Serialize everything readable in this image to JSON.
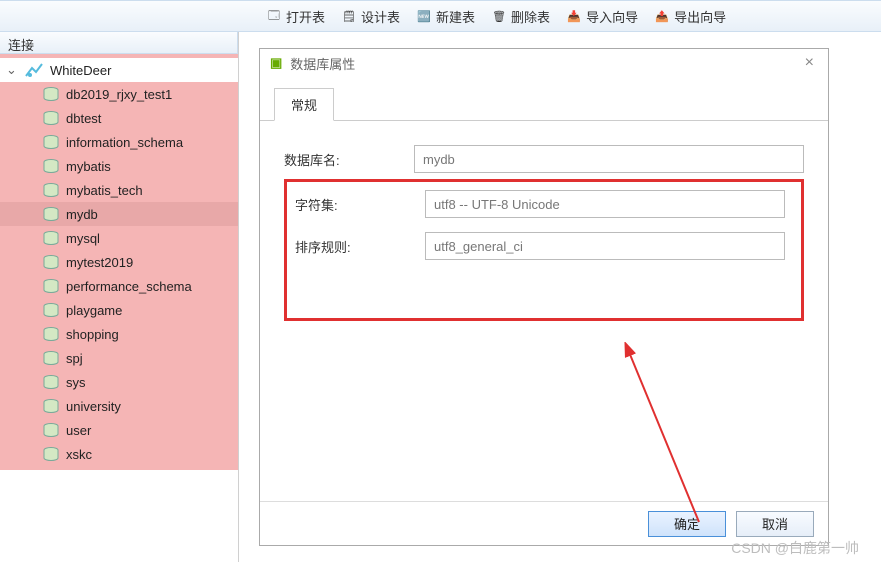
{
  "toolbar": {
    "open_table": "打开表",
    "design_table": "设计表",
    "new_table": "新建表",
    "delete_table": "删除表",
    "import_wizard": "导入向导",
    "export_wizard": "导出向导"
  },
  "panel": {
    "title": "连接"
  },
  "tree": {
    "connection": "WhiteDeer",
    "databases": [
      "db2019_rjxy_test1",
      "dbtest",
      "information_schema",
      "mybatis",
      "mybatis_tech",
      "mydb",
      "mysql",
      "mytest2019",
      "performance_schema",
      "playgame",
      "shopping",
      "spj",
      "sys",
      "university",
      "user",
      "xskc"
    ],
    "selected": "mydb"
  },
  "dialog": {
    "title": "数据库属性",
    "tab_general": "常规",
    "label_dbname": "数据库名:",
    "value_dbname": "mydb",
    "label_charset": "字符集:",
    "value_charset": "utf8 -- UTF-8 Unicode",
    "label_collation": "排序规则:",
    "value_collation": "utf8_general_ci",
    "btn_ok": "确定",
    "btn_cancel": "取消"
  },
  "watermark": "CSDN @白鹿第一帅"
}
